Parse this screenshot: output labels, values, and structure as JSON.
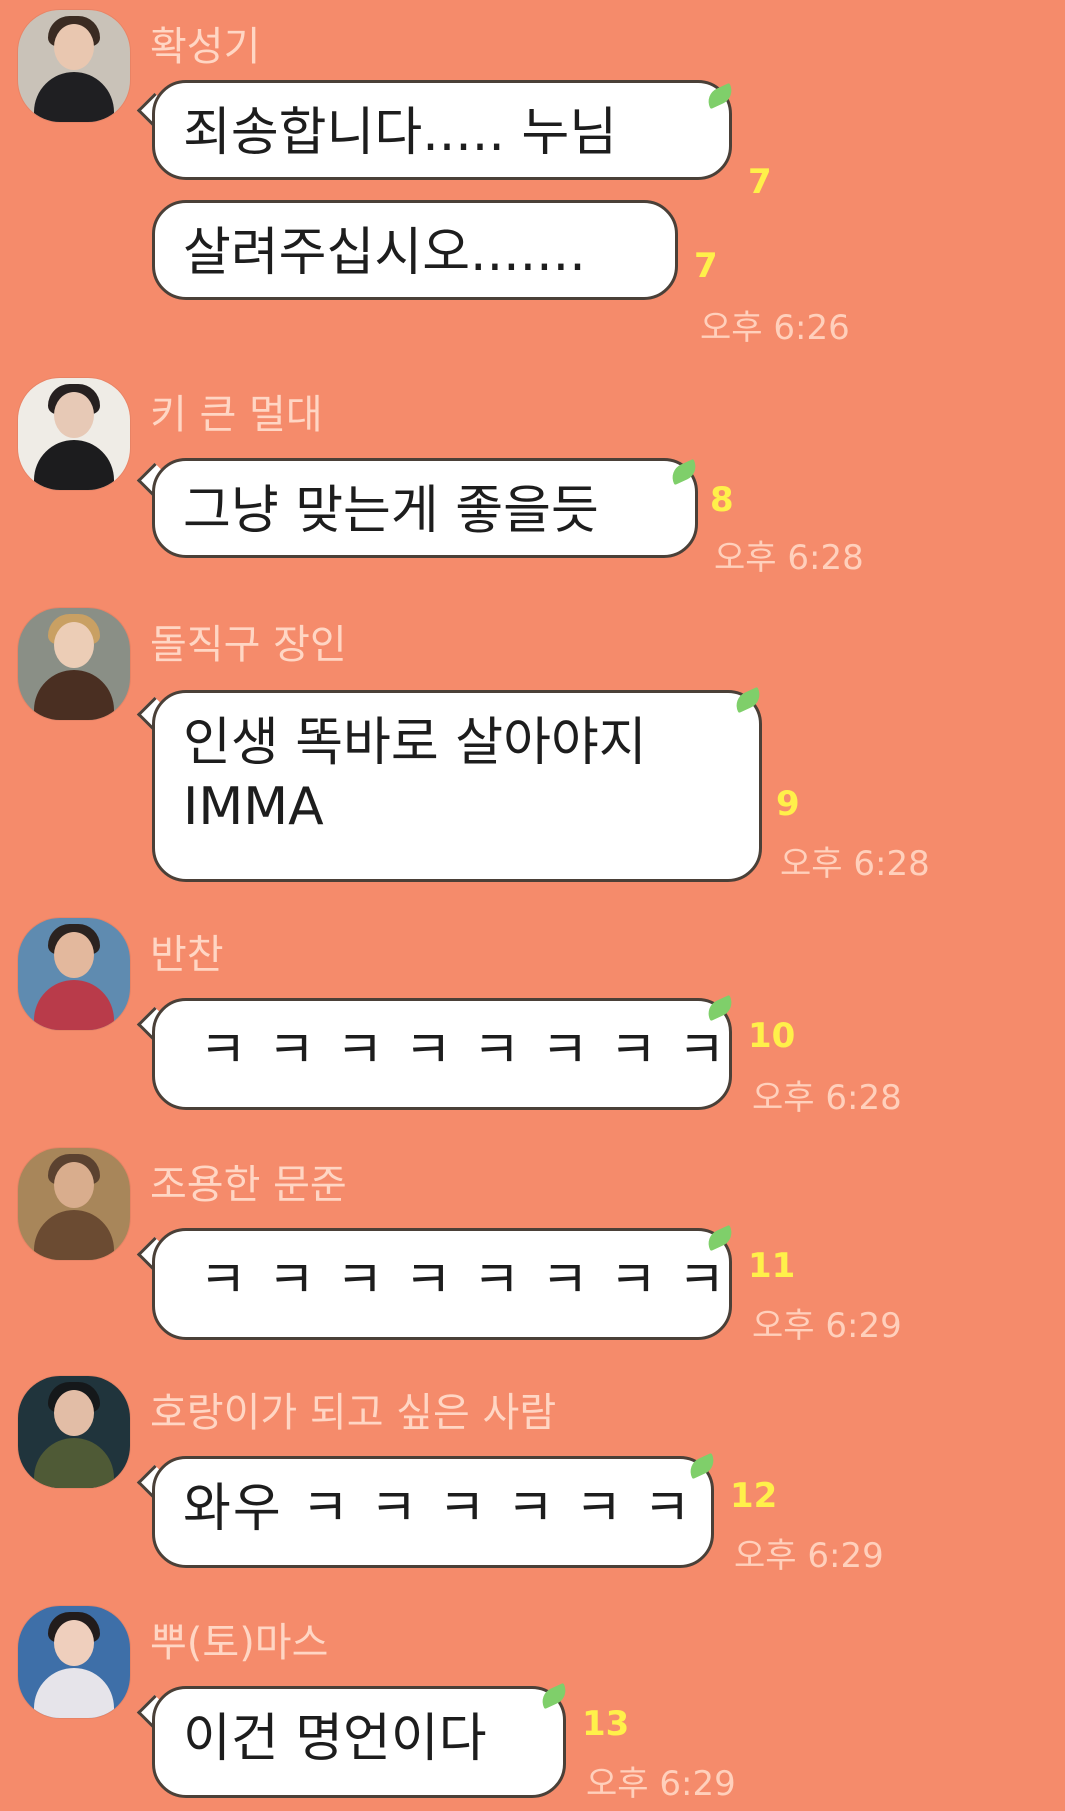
{
  "messages": [
    {
      "sender": "확성기",
      "bubbles": [
        {
          "text": "죄송합니다..... 누님",
          "count": "7",
          "time": ""
        },
        {
          "text": "살려주십시오.......",
          "count": "7",
          "time": "오후 6:26"
        }
      ]
    },
    {
      "sender": "키 큰 멀대",
      "bubbles": [
        {
          "text": "그냥 맞는게 좋을듯",
          "count": "8",
          "time": "오후 6:28"
        }
      ]
    },
    {
      "sender": "돌직구 장인",
      "bubbles": [
        {
          "text": "인생 똑바로 살아야지 IMMA",
          "count": "9",
          "time": "오후 6:28"
        }
      ]
    },
    {
      "sender": "반찬",
      "bubbles": [
        {
          "text": "ㅋ ㅋ ㅋ ㅋ ㅋ ㅋ ㅋ ㅋ",
          "count": "10",
          "time": "오후 6:28"
        }
      ]
    },
    {
      "sender": "조용한 문준",
      "bubbles": [
        {
          "text": "ㅋ ㅋ ㅋ ㅋ ㅋ ㅋ ㅋ ㅋ",
          "count": "11",
          "time": "오후 6:29"
        }
      ]
    },
    {
      "sender": "호랑이가 되고 싶은 사람",
      "bubbles": [
        {
          "text": "와우 ㅋ ㅋ ㅋ ㅋ ㅋ ㅋ",
          "count": "12",
          "time": "오후 6:29"
        }
      ]
    },
    {
      "sender": "뿌(토)마스",
      "bubbles": [
        {
          "text": "이건 명언이다",
          "count": "13",
          "time": "오후 6:29"
        }
      ]
    }
  ],
  "colors": {
    "background": "#f58b6b",
    "bubble": "#ffffff",
    "unread_count": "#fff04a",
    "leaf": "#7fcf6a"
  },
  "icons": {
    "bubble_decoration": "leaf-icon",
    "profile": "avatar-photo"
  }
}
